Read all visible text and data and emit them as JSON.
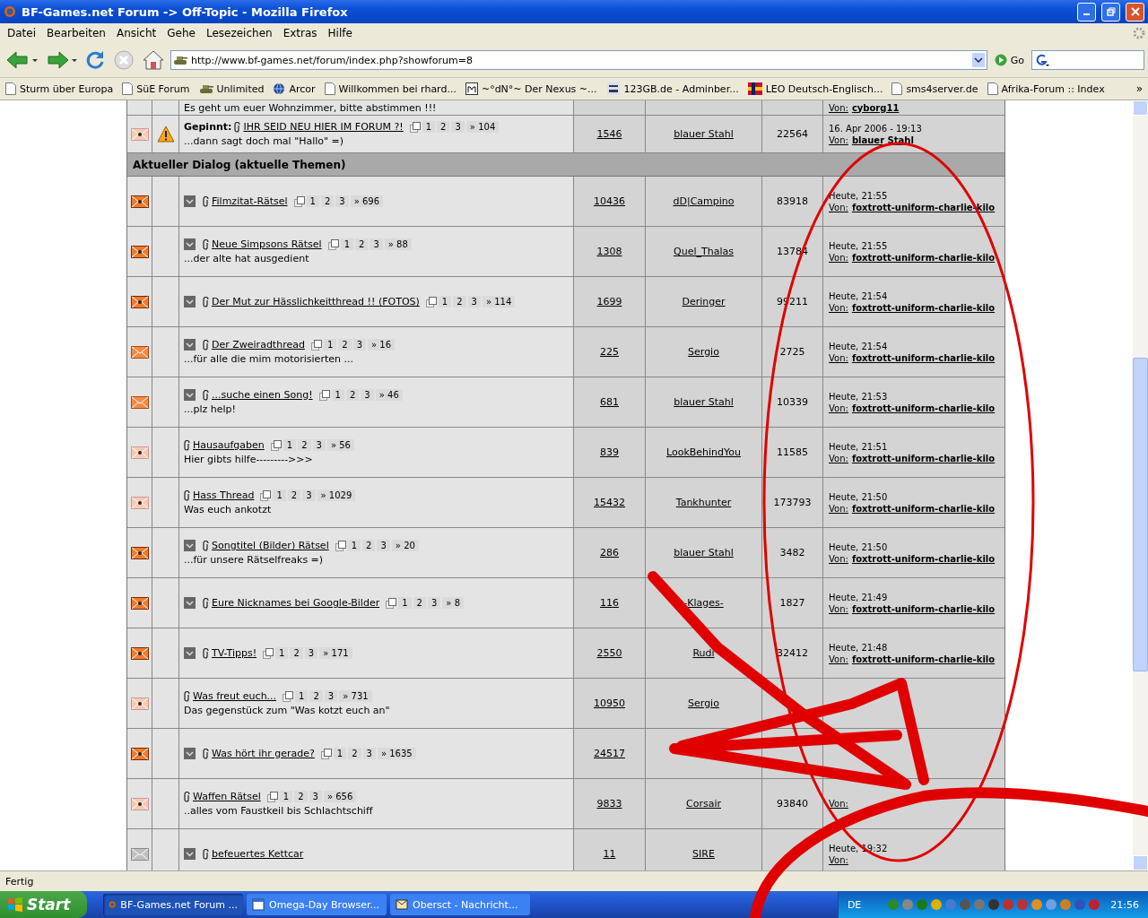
{
  "window": {
    "title": "BF-Games.net Forum -> Off-Topic - Mozilla Firefox"
  },
  "menu": [
    "Datei",
    "Bearbeiten",
    "Ansicht",
    "Gehe",
    "Lesezeichen",
    "Extras",
    "Hilfe"
  ],
  "toolbar": {
    "url": "http://www.bf-games.net/forum/index.php?showforum=8",
    "go": "Go"
  },
  "bookmarks": [
    {
      "label": "Sturm über Europa",
      "kind": "page"
    },
    {
      "label": "SüE Forum",
      "kind": "page"
    },
    {
      "label": "Unlimited",
      "kind": "tank"
    },
    {
      "label": "Arcor",
      "kind": "globe"
    },
    {
      "label": "Willkommen bei rhard...",
      "kind": "page"
    },
    {
      "label": "~°dN°~ Der Nexus ~...",
      "kind": "letter"
    },
    {
      "label": "123GB.de - Adminber...",
      "kind": "digits"
    },
    {
      "label": "LEO Deutsch-Englisch...",
      "kind": "flag"
    },
    {
      "label": "sms4server.de",
      "kind": "page"
    },
    {
      "label": "Afrika-Forum :: Index",
      "kind": "page"
    }
  ],
  "bookmarks_more": "»",
  "forum": {
    "partial_row": {
      "description": "Es geht um euer Wohnzimmer, bitte abstimmen !!!",
      "by_label": "Von:",
      "by": "cyborg11"
    },
    "pinned": {
      "kind": "faded",
      "prefix": "Gepinnt:",
      "title": "IHR SEID NEU HIER IM FORUM ?!",
      "pages": [
        "1",
        "2",
        "3"
      ],
      "last_page": "» 104",
      "description": "...dann sagt doch mal \"Hallo\" =)",
      "replies": "1546",
      "author": "blauer Stahl",
      "views": "22564",
      "last_post": {
        "date": "16. Apr 2006 - 19:13",
        "by_label": "Von:",
        "by": "blauer Stahl"
      }
    },
    "section": "Aktueller Dialog (aktuelle Themen)",
    "topics": [
      {
        "kind": "hot",
        "new_posts": true,
        "title": "Filmzitat-Rätsel",
        "pages": [
          "1",
          "2",
          "3"
        ],
        "last_page": "» 696",
        "replies": "10436",
        "author": "dD|Campino",
        "views": "83918",
        "last_post": {
          "date": "Heute, 21:55",
          "by_label": "Von:",
          "by": "foxtrott-uniform-charlie-kilo"
        }
      },
      {
        "kind": "hot",
        "new_posts": true,
        "title": "Neue Simpsons Rätsel",
        "pages": [
          "1",
          "2",
          "3"
        ],
        "last_page": "» 88",
        "description": "...der alte hat ausgedient",
        "replies": "1308",
        "author": "Quel_Thalas",
        "views": "13784",
        "last_post": {
          "date": "Heute, 21:55",
          "by_label": "Von:",
          "by": "foxtrott-uniform-charlie-kilo"
        }
      },
      {
        "kind": "hot",
        "new_posts": true,
        "title": "Der Mut zur Hässlichkeitthread !! (FOTOS)",
        "pages": [
          "1",
          "2",
          "3"
        ],
        "last_page": "» 114",
        "replies": "1699",
        "author": "Deringer",
        "views": "99211",
        "last_post": {
          "date": "Heute, 21:54",
          "by_label": "Von:",
          "by": "foxtrott-uniform-charlie-kilo"
        }
      },
      {
        "kind": "new",
        "new_posts": true,
        "title": "Der Zweiradthread",
        "pages": [
          "1",
          "2",
          "3"
        ],
        "last_page": "» 16",
        "description": "...für alle die mim motorisierten ...",
        "replies": "225",
        "author": "Sergio",
        "views": "2725",
        "last_post": {
          "date": "Heute, 21:54",
          "by_label": "Von:",
          "by": "foxtrott-uniform-charlie-kilo"
        }
      },
      {
        "kind": "new",
        "new_posts": true,
        "title": "...suche einen Song!",
        "pages": [
          "1",
          "2",
          "3"
        ],
        "last_page": "» 46",
        "description": "...plz help!",
        "replies": "681",
        "author": "blauer Stahl",
        "views": "10339",
        "last_post": {
          "date": "Heute, 21:53",
          "by_label": "Von:",
          "by": "foxtrott-uniform-charlie-kilo"
        }
      },
      {
        "kind": "faded",
        "new_posts": false,
        "title": "Hausaufgaben",
        "pages": [
          "1",
          "2",
          "3"
        ],
        "last_page": "» 56",
        "description": "Hier gibts hilfe--------->>>",
        "replies": "839",
        "author": "LookBehindYou",
        "views": "11585",
        "last_post": {
          "date": "Heute, 21:51",
          "by_label": "Von:",
          "by": "foxtrott-uniform-charlie-kilo"
        }
      },
      {
        "kind": "faded",
        "new_posts": false,
        "title": "Hass Thread",
        "pages": [
          "1",
          "2",
          "3"
        ],
        "last_page": "» 1029",
        "description": "Was euch ankotzt",
        "replies": "15432",
        "author": "Tankhunter",
        "views": "173793",
        "last_post": {
          "date": "Heute, 21:50",
          "by_label": "Von:",
          "by": "foxtrott-uniform-charlie-kilo"
        }
      },
      {
        "kind": "hot",
        "new_posts": true,
        "title": "Songtitel (Bilder) Rätsel",
        "pages": [
          "1",
          "2",
          "3"
        ],
        "last_page": "» 20",
        "description": "...für unsere Rätselfreaks =)",
        "replies": "286",
        "author": "blauer Stahl",
        "views": "3482",
        "last_post": {
          "date": "Heute, 21:50",
          "by_label": "Von:",
          "by": "foxtrott-uniform-charlie-kilo"
        }
      },
      {
        "kind": "hot",
        "new_posts": true,
        "title": "Eure Nicknames bei Google-Bilder",
        "pages": [
          "1",
          "2",
          "3"
        ],
        "last_page": "» 8",
        "replies": "116",
        "author": "-Klages-",
        "views": "1827",
        "last_post": {
          "date": "Heute, 21:49",
          "by_label": "Von:",
          "by": "foxtrott-uniform-charlie-kilo"
        }
      },
      {
        "kind": "hot",
        "new_posts": true,
        "title": "TV-Tipps!",
        "pages": [
          "1",
          "2",
          "3"
        ],
        "last_page": "» 171",
        "replies": "2550",
        "author": "Rudi",
        "views": "32412",
        "last_post": {
          "date": "Heute, 21:48",
          "by_label": "Von:",
          "by": "foxtrott-uniform-charlie-kilo"
        }
      },
      {
        "kind": "faded",
        "new_posts": false,
        "title": "Was freut euch...",
        "pages": [
          "1",
          "2",
          "3"
        ],
        "last_page": "» 731",
        "description": "Das gegenstück zum \"Was kotzt euch an\"",
        "replies": "10950",
        "author": "Sergio"
      },
      {
        "kind": "hot",
        "new_posts": true,
        "title": "Was hört ihr gerade?",
        "pages": [
          "1",
          "2",
          "3"
        ],
        "last_page": "» 1635",
        "replies": "24517"
      },
      {
        "kind": "faded",
        "new_posts": false,
        "title": "Waffen Rätsel",
        "pages": [
          "1",
          "2",
          "3"
        ],
        "last_page": "» 656",
        "description": "..alles vom Faustkeil bis Schlachtschiff",
        "replies": "9833",
        "author": "Corsair",
        "views": "93840",
        "last_post": {
          "by_label": "Von:"
        }
      },
      {
        "kind": "old",
        "new_posts": true,
        "title": "befeuertes Kettcar",
        "replies": "11",
        "author": "SIRE",
        "last_post": {
          "date": "Heute, 19:32",
          "by_label": "Von:"
        }
      }
    ]
  },
  "status_bar": "Fertig",
  "taskbar": {
    "start": "Start",
    "tasks": [
      {
        "label": "BF-Games.net Forum ...",
        "kind": "browser",
        "selected": true
      },
      {
        "label": "Omega-Day Browser...",
        "kind": "window",
        "selected": false
      },
      {
        "label": "Obersct - Nachricht...",
        "kind": "mail",
        "selected": false
      }
    ],
    "language": "DE",
    "clock": "21:56"
  }
}
